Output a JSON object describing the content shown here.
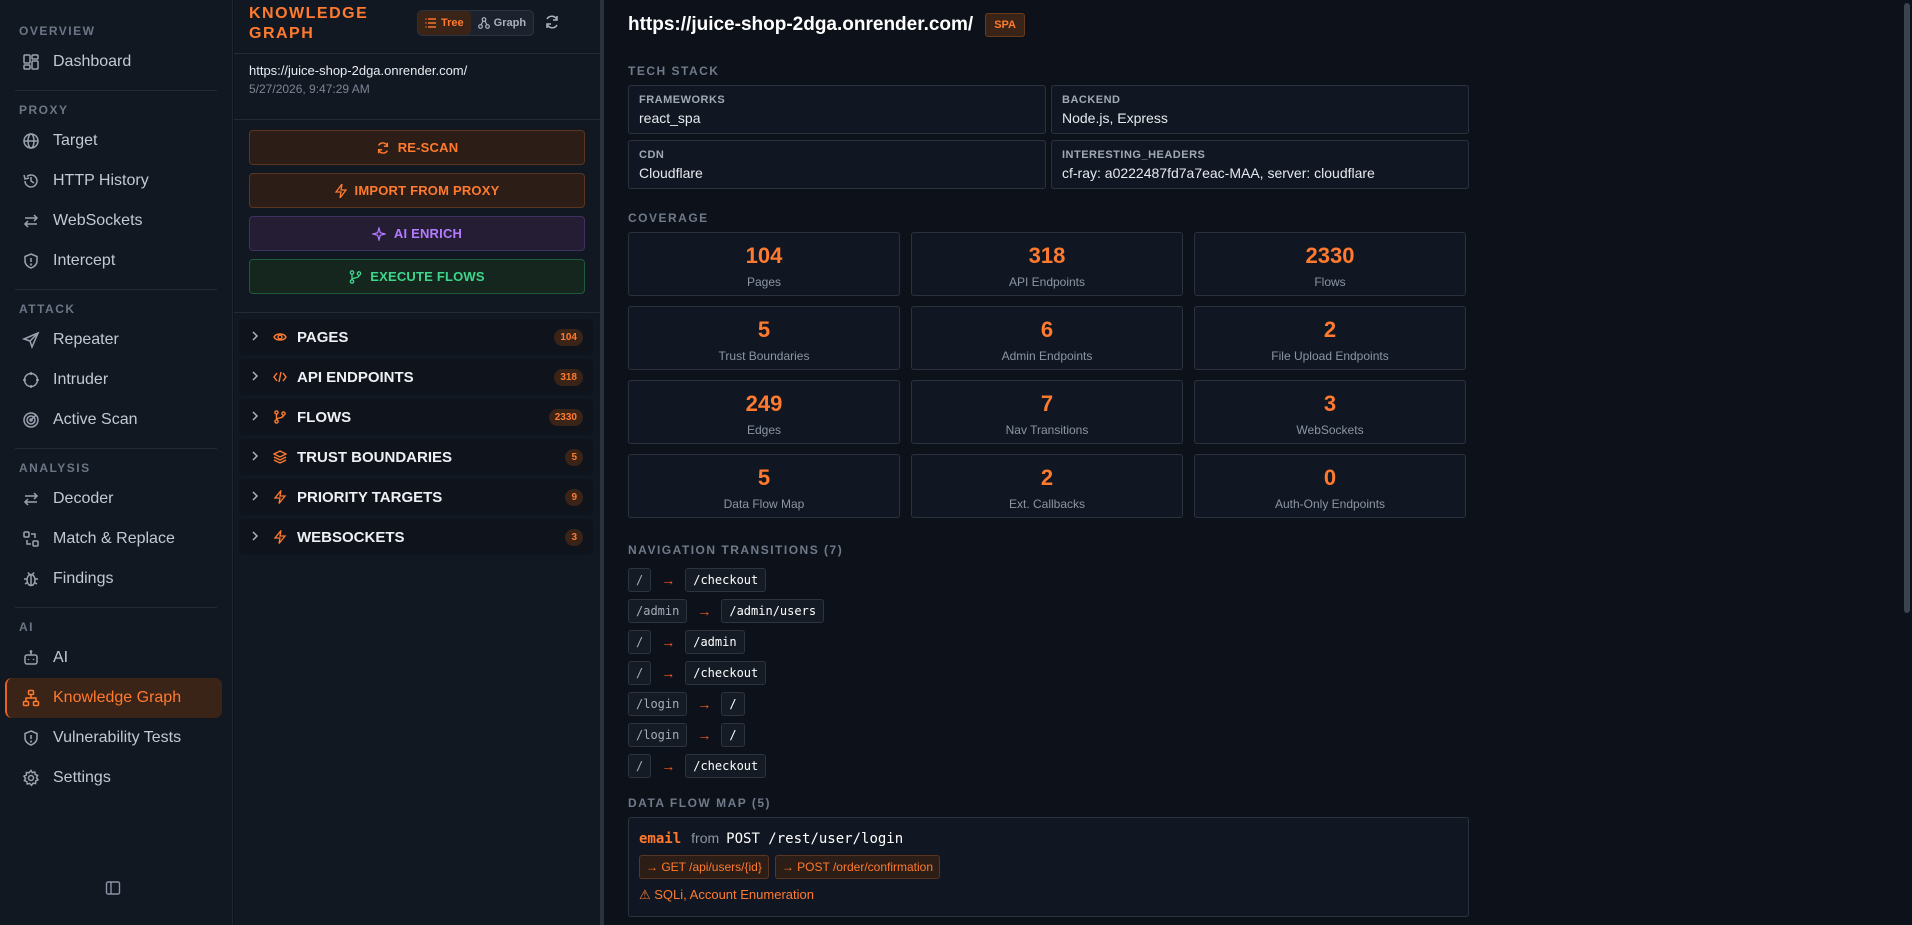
{
  "sidebar": {
    "sections": [
      {
        "heading": "OVERVIEW",
        "items": [
          {
            "label": "Dashboard",
            "icon": "dashboard-icon"
          }
        ]
      },
      {
        "heading": "PROXY",
        "items": [
          {
            "label": "Target",
            "icon": "globe-icon"
          },
          {
            "label": "HTTP History",
            "icon": "history-icon"
          },
          {
            "label": "WebSockets",
            "icon": "arrows-icon"
          },
          {
            "label": "Intercept",
            "icon": "shield-icon"
          }
        ]
      },
      {
        "heading": "ATTACK",
        "items": [
          {
            "label": "Repeater",
            "icon": "send-icon"
          },
          {
            "label": "Intruder",
            "icon": "crosshair-icon"
          },
          {
            "label": "Active Scan",
            "icon": "radar-icon"
          }
        ]
      },
      {
        "heading": "ANALYSIS",
        "items": [
          {
            "label": "Decoder",
            "icon": "swap-icon"
          },
          {
            "label": "Match & Replace",
            "icon": "replace-icon"
          },
          {
            "label": "Findings",
            "icon": "bug-icon"
          }
        ]
      },
      {
        "heading": "AI",
        "items": [
          {
            "label": "AI",
            "icon": "bot-icon"
          },
          {
            "label": "Knowledge Graph",
            "icon": "graph-icon",
            "active": true
          },
          {
            "label": "Vulnerability Tests",
            "icon": "shield-icon"
          },
          {
            "label": "Settings",
            "icon": "gear-icon"
          }
        ]
      }
    ]
  },
  "panel": {
    "title": "KNOWLEDGE GRAPH",
    "toggle": {
      "tree": "Tree",
      "graph": "Graph"
    },
    "url": "https://juice-shop-2dga.onrender.com/",
    "date": "5/27/2026, 9:47:29 AM",
    "actions": {
      "rescan": "RE-SCAN",
      "import": "IMPORT FROM PROXY",
      "enrich": "AI ENRICH",
      "execute": "EXECUTE FLOWS"
    },
    "tree": [
      {
        "label": "PAGES",
        "count": "104",
        "icon": "eye-icon"
      },
      {
        "label": "API ENDPOINTS",
        "count": "318",
        "icon": "code-icon"
      },
      {
        "label": "FLOWS",
        "count": "2330",
        "icon": "branch-icon"
      },
      {
        "label": "TRUST BOUNDARIES",
        "count": "5",
        "icon": "layers-icon"
      },
      {
        "label": "PRIORITY TARGETS",
        "count": "9",
        "icon": "bolt-icon"
      },
      {
        "label": "WEBSOCKETS",
        "count": "3",
        "icon": "bolt-icon"
      }
    ]
  },
  "main": {
    "url": "https://juice-shop-2dga.onrender.com/",
    "badge": "SPA",
    "tech_title": "TECH STACK",
    "tech": [
      {
        "label": "FRAMEWORKS",
        "value": "react_spa"
      },
      {
        "label": "BACKEND",
        "value": "Node.js, Express"
      },
      {
        "label": "CDN",
        "value": "Cloudflare"
      },
      {
        "label": "INTERESTING_HEADERS",
        "value": "cf-ray: a0222487fd7a7eac-MAA, server: cloudflare"
      }
    ],
    "coverage_title": "COVERAGE",
    "coverage": [
      {
        "num": "104",
        "label": "Pages"
      },
      {
        "num": "318",
        "label": "API Endpoints"
      },
      {
        "num": "2330",
        "label": "Flows"
      },
      {
        "num": "5",
        "label": "Trust Boundaries"
      },
      {
        "num": "6",
        "label": "Admin Endpoints"
      },
      {
        "num": "2",
        "label": "File Upload Endpoints"
      },
      {
        "num": "249",
        "label": "Edges"
      },
      {
        "num": "7",
        "label": "Nav Transitions"
      },
      {
        "num": "3",
        "label": "WebSockets"
      },
      {
        "num": "5",
        "label": "Data Flow Map"
      },
      {
        "num": "2",
        "label": "Ext. Callbacks"
      },
      {
        "num": "0",
        "label": "Auth-Only Endpoints"
      }
    ],
    "nav_title": "NAVIGATION TRANSITIONS (7)",
    "nav": [
      {
        "from": "/",
        "to": "/checkout"
      },
      {
        "from": "/admin",
        "to": "/admin/users"
      },
      {
        "from": "/",
        "to": "/admin"
      },
      {
        "from": "/",
        "to": "/checkout"
      },
      {
        "from": "/login",
        "to": "/"
      },
      {
        "from": "/login",
        "to": "/"
      },
      {
        "from": "/",
        "to": "/checkout"
      }
    ],
    "arrow": "→",
    "flow_title": "DATA FLOW MAP (5)",
    "flow": {
      "field": "email",
      "from_word": "from",
      "source": "POST /rest/user/login",
      "sinks": [
        "→ GET /api/users/{id}",
        "→ POST /order/confirmation"
      ],
      "vulns": "⚠ SQLi, Account Enumeration"
    }
  }
}
